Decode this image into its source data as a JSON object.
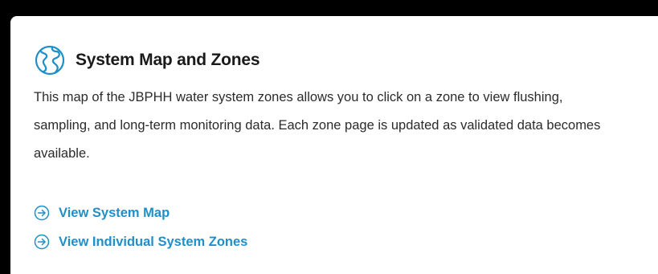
{
  "card": {
    "title": "System Map and Zones",
    "icon": "globe-icon",
    "description": "This map of the JBPHH water system zones allows you to click on a zone to view flushing, sampling, and long-term monitoring data. Each zone page is updated as validated data becomes available.",
    "links": [
      {
        "label": "View System Map",
        "icon": "arrow-circle-right-icon"
      },
      {
        "label": "View Individual System Zones",
        "icon": "arrow-circle-right-icon"
      }
    ]
  },
  "colors": {
    "accent": "#1f8fc8",
    "text": "#2b2b2b",
    "title": "#1a1a1a",
    "frame": "#000000",
    "card_background": "#ffffff"
  }
}
